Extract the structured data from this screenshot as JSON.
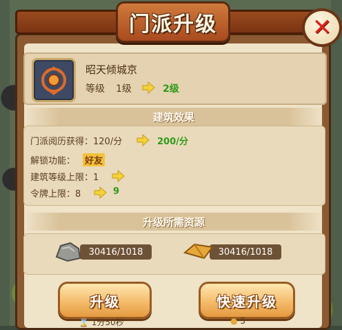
{
  "dialog": {
    "title": "门派升级",
    "close_icon": "close-icon"
  },
  "building": {
    "name": "昭天倾城京",
    "level_label": "等级",
    "level_current": "1级",
    "level_next": "2级",
    "emblem_icon": "sect-emblem-icon"
  },
  "effects": {
    "header": "建筑效果",
    "rows": [
      {
        "label": "门派阅历获得：",
        "current": "120/分",
        "next": "200/分"
      },
      {
        "label": "解锁功能：",
        "current": "",
        "next": "好友"
      },
      {
        "label": "建筑等级上限：",
        "current": "1",
        "next": ""
      },
      {
        "label": "令牌上限：",
        "current": "8",
        "next": "9"
      }
    ]
  },
  "resources": {
    "header": "升级所需资源",
    "items": [
      {
        "icon": "stone-icon",
        "amount": "30416/1018"
      },
      {
        "icon": "gold-brick-icon",
        "amount": "30416/1018"
      }
    ]
  },
  "buttons": {
    "upgrade": "升级",
    "quick_upgrade": "快速升级"
  },
  "footer": {
    "upgrade_time": "1分50秒",
    "quick_cost": "5"
  },
  "colors": {
    "accent_green": "#2e9a18",
    "title_bg": "#b0521f",
    "close_red": "#d9261c"
  }
}
